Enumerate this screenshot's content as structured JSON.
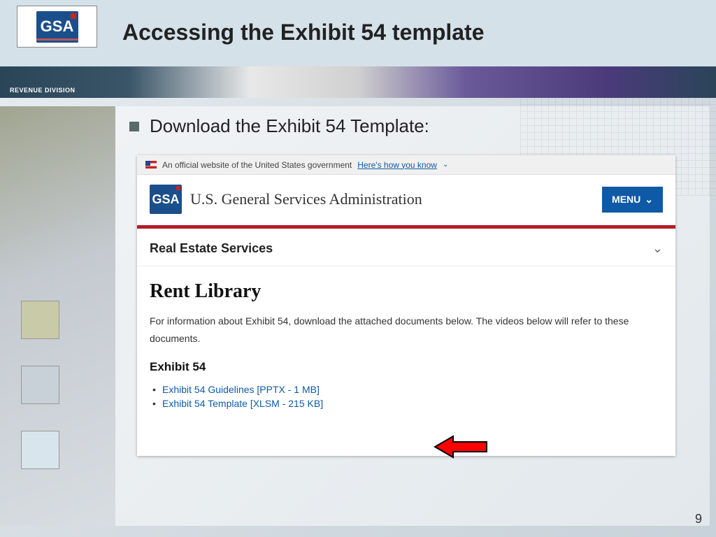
{
  "header": {
    "logo_text": "GSA",
    "title": "Accessing the Exhibit 54 template",
    "sub_label": "REVENUE DIVISION"
  },
  "bullet": "Download the Exhibit 54 Template:",
  "screenshot": {
    "gov_banner_text": "An official website of the United States government",
    "gov_banner_link": "Here's how you know",
    "gsa_logo": "GSA",
    "gsa_name": "U.S. General Services Administration",
    "menu_label": "MENU",
    "section": "Real Estate Services",
    "page_title": "Rent Library",
    "description": "For information about Exhibit 54, download the attached documents below. The videos below will refer to these documents.",
    "doc_heading": "Exhibit 54",
    "docs": [
      "Exhibit 54 Guidelines [PPTX - 1 MB]",
      "Exhibit 54 Template [XLSM - 215 KB]"
    ]
  },
  "page_number": "9"
}
